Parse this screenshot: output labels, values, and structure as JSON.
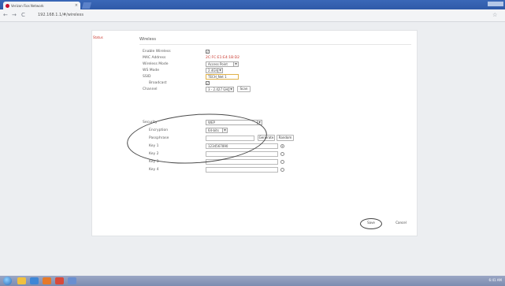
{
  "browser": {
    "tab_title": "Verizon Fios Network",
    "tab_close": "×",
    "url": "192.168.1.1/#/wireless",
    "nav": {
      "back": "←",
      "forward": "→",
      "reload": "C",
      "star": "☆"
    }
  },
  "sidebar": {
    "active_link": "Status"
  },
  "section": {
    "title": "Wireless"
  },
  "fields": {
    "enable_wireless": {
      "label": "Enable Wireless",
      "checked": true
    },
    "mac_address": {
      "label": "MAC Address",
      "value": "2C:FC:E1:E4:1B:D2"
    },
    "wireless_mode": {
      "label": "Wireless Mode",
      "value": "Access Point"
    },
    "wds_mode": {
      "label": "WS Mode",
      "value": "2.4Gh"
    },
    "ssid": {
      "label": "SSID",
      "value": "TECH_Net 1"
    },
    "broadcast": {
      "label": "Broadcast",
      "checked": true
    },
    "channel": {
      "label": "Channel",
      "value": "3 - 2.427 GHz",
      "scan_label": "Scan"
    },
    "security": {
      "label": "Security",
      "value": "WEP"
    },
    "encryption": {
      "label": "Encryption",
      "value": "64-bits"
    },
    "passphrase": {
      "label": "Passphrase",
      "value": "",
      "generate_label": "Generate",
      "random_label": "Random"
    },
    "keys": [
      {
        "label": "Key 1",
        "value": "1234567890",
        "selected": true
      },
      {
        "label": "Key 2",
        "value": "",
        "selected": false
      },
      {
        "label": "Key 3",
        "value": "",
        "selected": false
      },
      {
        "label": "Key 4",
        "value": "",
        "selected": false
      }
    ]
  },
  "actions": {
    "save_label": "Save",
    "cancel_label": "Cancel"
  },
  "taskbar": {
    "clock": "6:41 AM"
  }
}
